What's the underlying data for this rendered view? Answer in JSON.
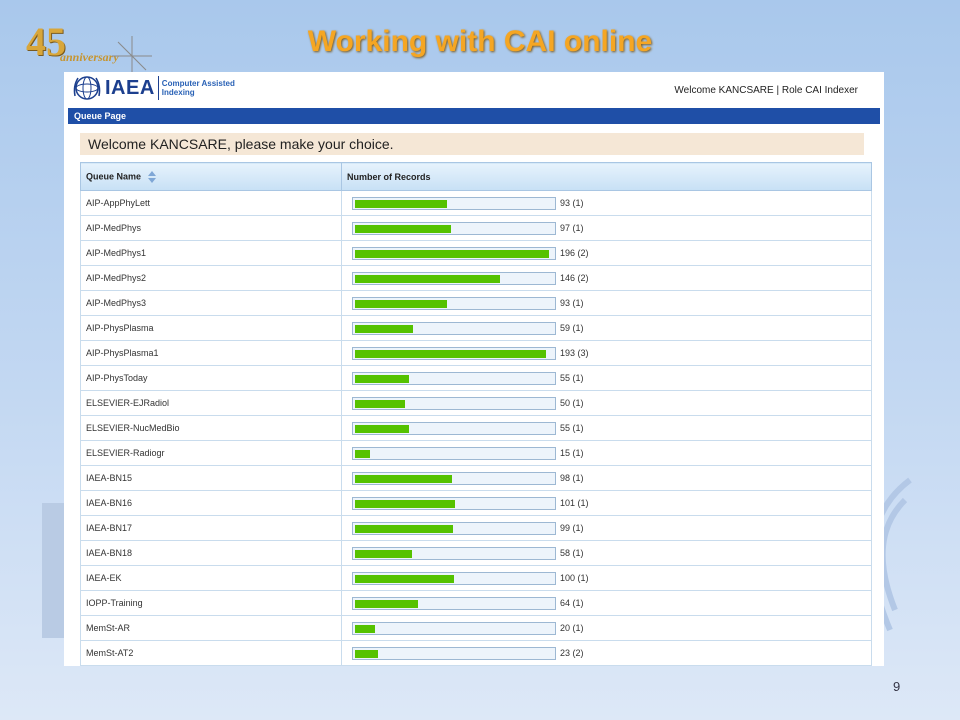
{
  "slide": {
    "title": "Working with CAI online",
    "page_number": "9",
    "anniversary_logo": {
      "big": "45",
      "small": "anniversary"
    }
  },
  "app": {
    "logo_text": "IAEA",
    "logo_subtitle_line1": "Computer Assisted",
    "logo_subtitle_line2": "Indexing",
    "welcome_role": "Welcome KANCSARE | Role CAI Indexer",
    "queue_bar_label": "Queue Page",
    "welcome_message": "Welcome KANCSARE, please make your choice."
  },
  "table": {
    "columns": [
      "Queue Name",
      "Number of Records"
    ],
    "rows": [
      {
        "name": "AIP-AppPhyLett",
        "count": "93 (1)",
        "value": 93
      },
      {
        "name": "AIP-MedPhys",
        "count": "97 (1)",
        "value": 97
      },
      {
        "name": "AIP-MedPhys1",
        "count": "196 (2)",
        "value": 196
      },
      {
        "name": "AIP-MedPhys2",
        "count": "146 (2)",
        "value": 146
      },
      {
        "name": "AIP-MedPhys3",
        "count": "93 (1)",
        "value": 93
      },
      {
        "name": "AIP-PhysPlasma",
        "count": "59 (1)",
        "value": 59
      },
      {
        "name": "AIP-PhysPlasma1",
        "count": "193 (3)",
        "value": 193
      },
      {
        "name": "AIP-PhysToday",
        "count": "55 (1)",
        "value": 55
      },
      {
        "name": "ELSEVIER-EJRadiol",
        "count": "50 (1)",
        "value": 50
      },
      {
        "name": "ELSEVIER-NucMedBio",
        "count": "55 (1)",
        "value": 55
      },
      {
        "name": "ELSEVIER-Radiogr",
        "count": "15 (1)",
        "value": 15
      },
      {
        "name": "IAEA-BN15",
        "count": "98 (1)",
        "value": 98
      },
      {
        "name": "IAEA-BN16",
        "count": "101 (1)",
        "value": 101
      },
      {
        "name": "IAEA-BN17",
        "count": "99 (1)",
        "value": 99
      },
      {
        "name": "IAEA-BN18",
        "count": "58 (1)",
        "value": 58
      },
      {
        "name": "IAEA-EK",
        "count": "100 (1)",
        "value": 100
      },
      {
        "name": "IOPP-Training",
        "count": "64 (1)",
        "value": 64
      },
      {
        "name": "MemSt-AR",
        "count": "20 (1)",
        "value": 20
      },
      {
        "name": "MemSt-AT2",
        "count": "23 (2)",
        "value": 23
      }
    ],
    "bar_max": 200,
    "bar_color": "#55c200"
  },
  "colors": {
    "title": "#f5a623",
    "nav_bar": "#1f4fa7",
    "welcome_box": "#f5e7d6"
  }
}
